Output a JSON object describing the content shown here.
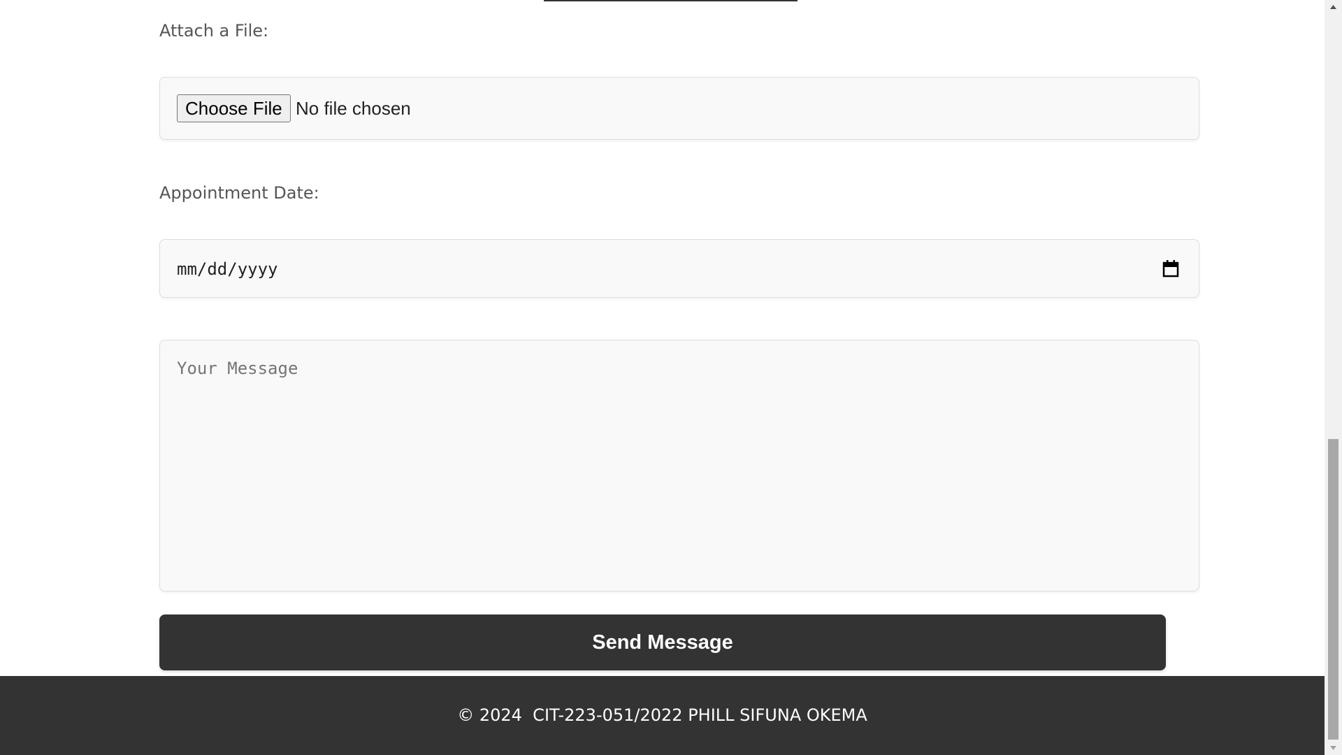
{
  "form": {
    "attach_label": "Attach a File:",
    "choose_file_label": "Choose File",
    "no_file_text": "No file chosen",
    "date_label": "Appointment Date:",
    "date_placeholder": "mm/dd/yyyy",
    "message_placeholder": "Your Message",
    "send_label": "Send Message"
  },
  "footer": {
    "text": "© 2024  CIT-223-051/2022 PHILL SIFUNA OKEMA"
  },
  "colors": {
    "button_bg": "#333333",
    "footer_bg": "#333333",
    "field_bg": "#f9f9f9"
  },
  "scroll": {
    "position_fraction": 1.0
  }
}
